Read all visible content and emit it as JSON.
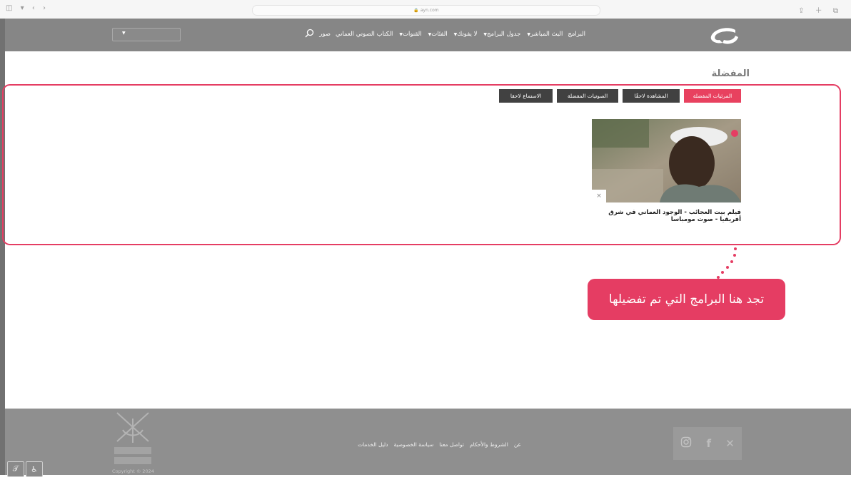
{
  "browser": {
    "url": "ayn.com",
    "left_controls": "◫ ▾ ‹ ›",
    "right_controls": "⇪ ＋ ⧉"
  },
  "header": {
    "nav": [
      {
        "label": "البرامج",
        "dropdown": false
      },
      {
        "label": "البث المباشر",
        "dropdown": true
      },
      {
        "label": "جدول البرامج",
        "dropdown": true
      },
      {
        "label": "لا يفوتك",
        "dropdown": true
      },
      {
        "label": "الفئات",
        "dropdown": true
      },
      {
        "label": "القنوات",
        "dropdown": true
      },
      {
        "label": "الكتاب الصوتي العماني",
        "dropdown": false
      },
      {
        "label": "صور",
        "dropdown": false
      }
    ],
    "search_icon": "search-icon"
  },
  "page": {
    "title": "المفضلة"
  },
  "tabs": [
    {
      "label": "المرئيات المفضلة",
      "active": true
    },
    {
      "label": "المشاهدة لاحقًا",
      "active": false
    },
    {
      "label": "الصوتيات المفضلة",
      "active": false
    },
    {
      "label": "الاستماع لاحقا",
      "active": false
    }
  ],
  "favorite_item": {
    "title": "فيلم بيت العجائب - الوجود العماني في شرق أفريقيا - صوت مومباسا",
    "remove_icon": "×"
  },
  "callout": {
    "text": "تجد هنا البرامج التي تم تفضيلها"
  },
  "footer": {
    "links": [
      "عن",
      "الشروط والأحكام",
      "تواصل معنا",
      "سياسة الخصوصية",
      "دليل الخدمات"
    ],
    "copyright": "Copyright © 2024",
    "social": [
      "instagram-icon",
      "facebook-icon",
      "x-icon"
    ]
  },
  "colors": {
    "accent": "#e53d63",
    "header_bg": "#868686",
    "footer_bg": "#8f8f8f",
    "tab_dark": "#414141"
  }
}
